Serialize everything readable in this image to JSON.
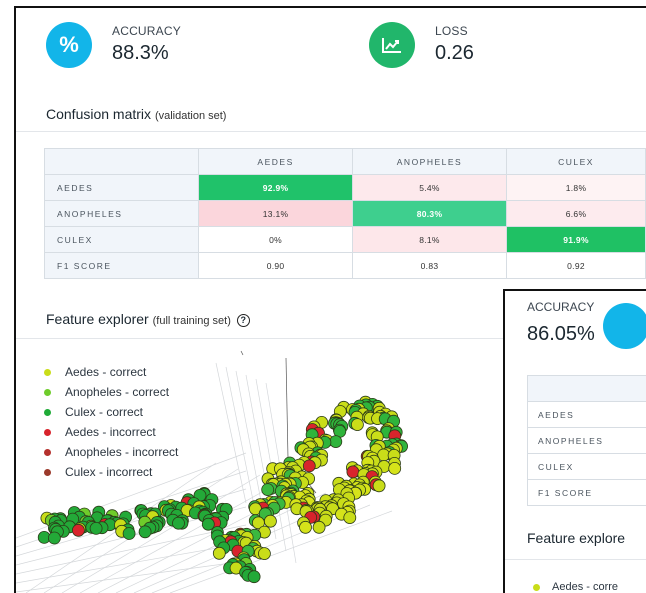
{
  "metrics": {
    "accuracy": {
      "label": "ACCURACY",
      "value": "88.3%",
      "icon": "percent-icon",
      "color": "#12b5e9"
    },
    "loss": {
      "label": "LOSS",
      "value": "0.26",
      "icon": "chart-trend-icon",
      "color": "#21b66b"
    }
  },
  "confusion": {
    "title": "Confusion matrix",
    "subtitle": "(validation set)",
    "columns": [
      "AEDES",
      "ANOPHELES",
      "CULEX"
    ],
    "rows": [
      {
        "label": "AEDES",
        "cells": [
          "92.9%",
          "5.4%",
          "1.8%"
        ]
      },
      {
        "label": "ANOPHELES",
        "cells": [
          "13.1%",
          "80.3%",
          "6.6%"
        ]
      },
      {
        "label": "CULEX",
        "cells": [
          "0%",
          "8.1%",
          "91.9%"
        ]
      },
      {
        "label": "F1 SCORE",
        "cells": [
          "0.90",
          "0.83",
          "0.92"
        ]
      }
    ]
  },
  "explorer": {
    "title": "Feature explorer",
    "subtitle": "(full training set)",
    "help_icon": "?",
    "legend": [
      {
        "label": "Aedes - correct",
        "color": "#c9dd19"
      },
      {
        "label": "Anopheles - correct",
        "color": "#6fcc2b"
      },
      {
        "label": "Culex - correct",
        "color": "#1fab37"
      },
      {
        "label": "Aedes - incorrect",
        "color": "#d8242c"
      },
      {
        "label": "Anopheles - incorrect",
        "color": "#b5312d"
      },
      {
        "label": "Culex - incorrect",
        "color": "#9b3a2b"
      }
    ]
  },
  "overlay": {
    "accuracy_label": "ACCURACY",
    "accuracy_value": "86.05%",
    "rows": [
      "AEDES",
      "ANOPHELES",
      "CULEX",
      "F1 SCORE"
    ],
    "explorer_title": "Feature explore",
    "legend_partial": "Aedes - corre"
  },
  "colors": {
    "diag_high": "#20c26a",
    "diag_mid": "#3ecf8e",
    "offdiag_pink": "#fde7ea",
    "offdiag_pink_strong": "#fbd3da"
  }
}
